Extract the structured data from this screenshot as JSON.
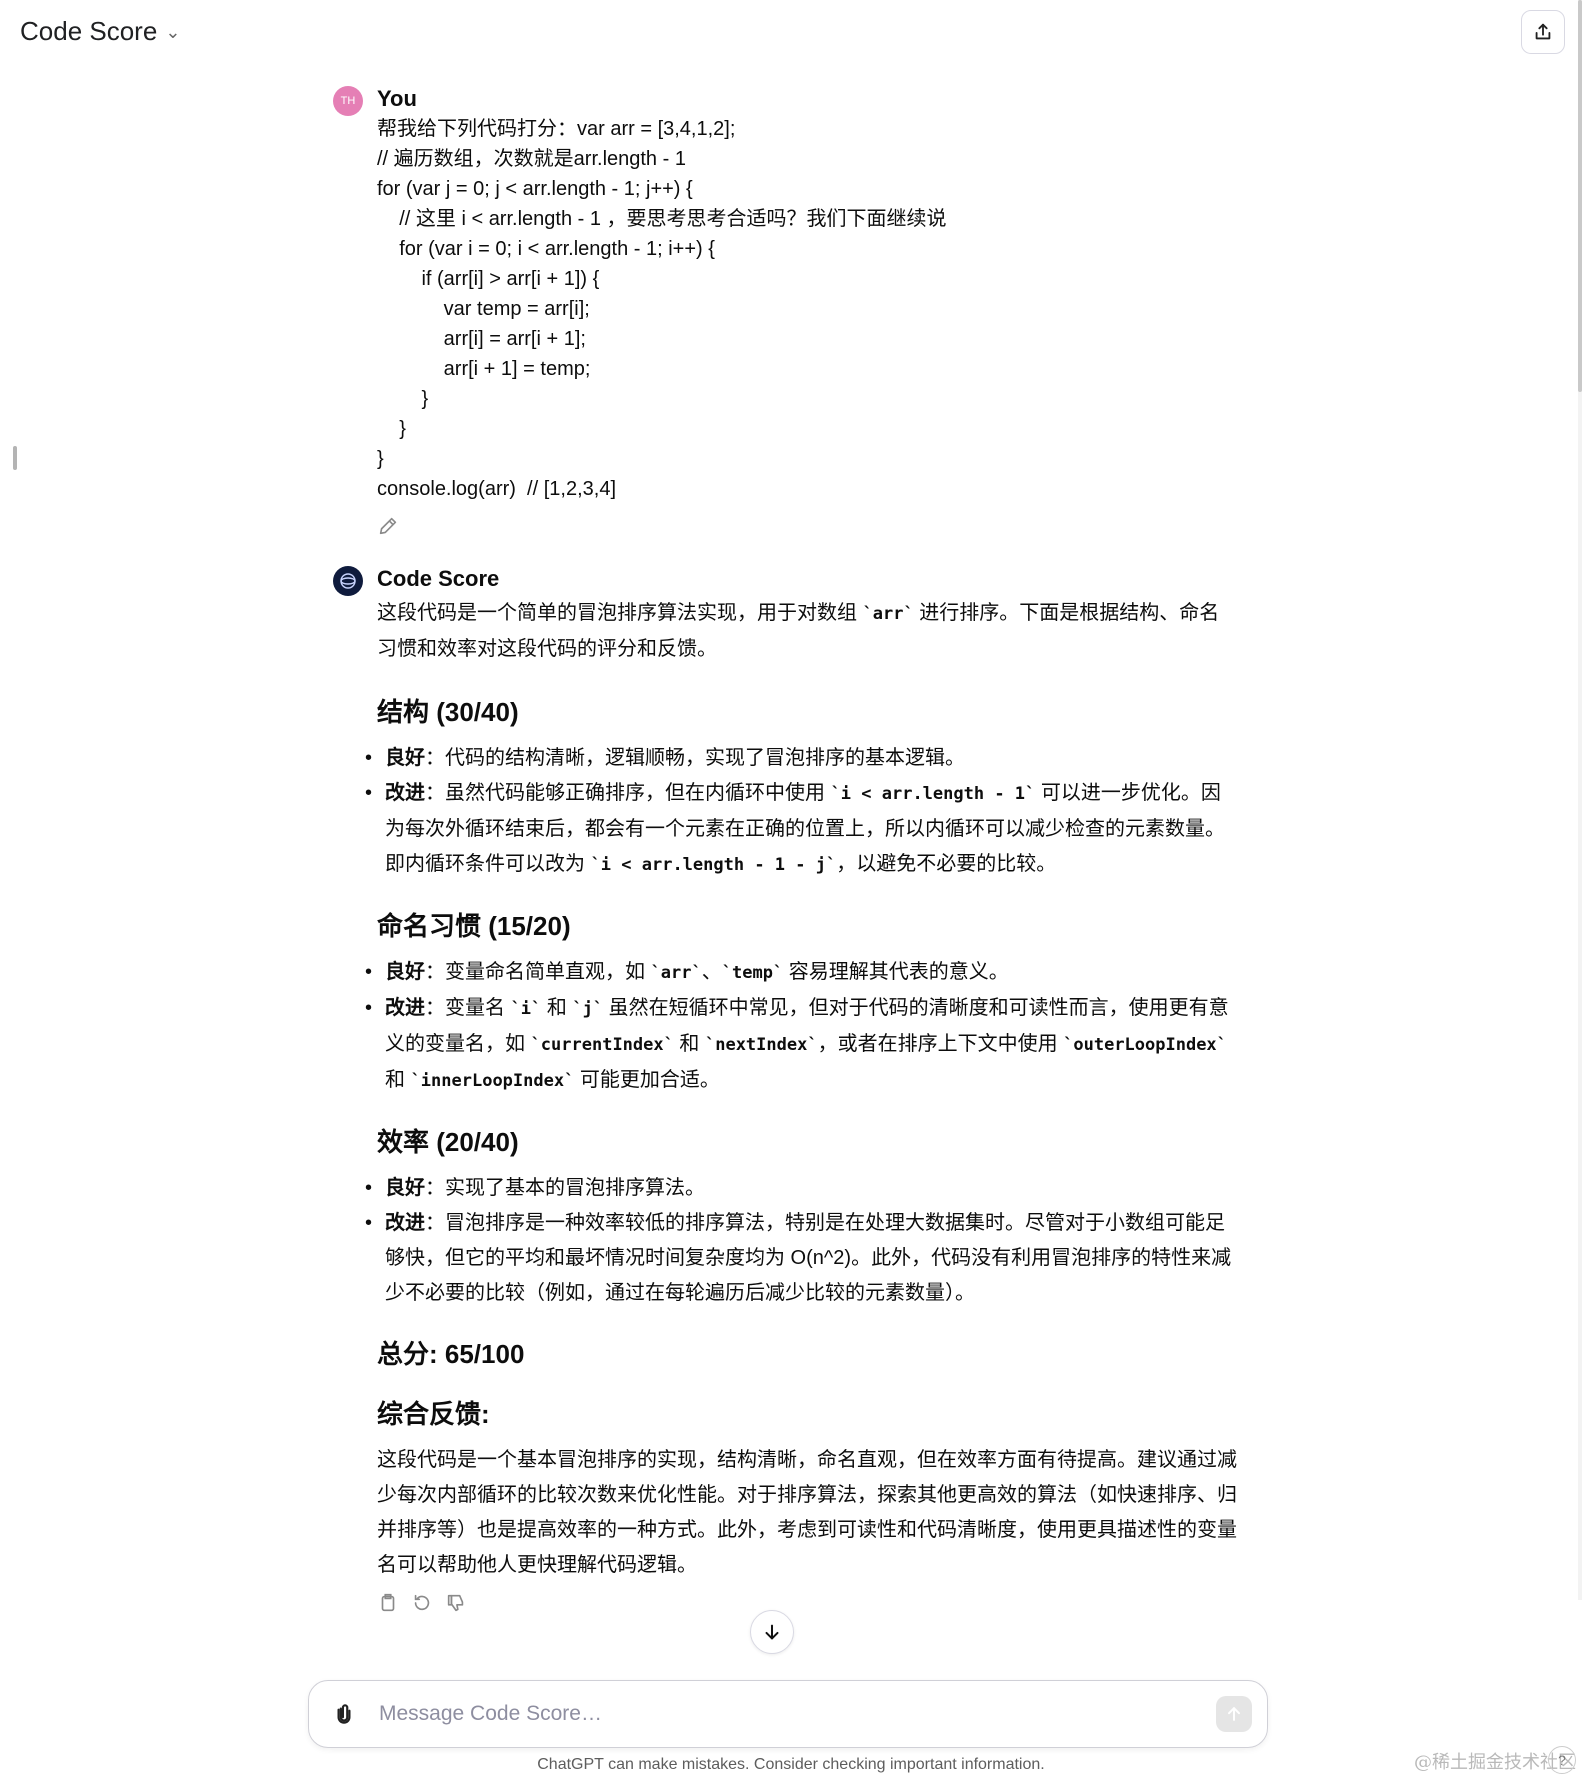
{
  "header": {
    "title": "Code Score"
  },
  "user_message": {
    "author": "You",
    "avatar_initials": "TH",
    "lines": [
      "帮我给下列代码打分：var arr = [3,4,1,2];",
      "// 遍历数组，次数就是arr.length - 1",
      "for (var j = 0; j < arr.length - 1; j++) {",
      "    // 这里 i < arr.length - 1 ，要思考思考合适吗？我们下面继续说",
      "    for (var i = 0; i < arr.length - 1; i++) {",
      "        if (arr[i] > arr[i + 1]) {",
      "            var temp = arr[i];",
      "            arr[i] = arr[i + 1];",
      "            arr[i + 1] = temp;",
      "        }",
      "    }",
      "}",
      "console.log(arr)  // [1,2,3,4]"
    ]
  },
  "bot_message": {
    "author": "Code Score",
    "intro": {
      "a": "这段代码是一个简单的冒泡排序算法实现，用于对数组 ",
      "code": "`arr`",
      "b": " 进行排序。下面是根据结构、命名习惯和效率对这段代码的评分和反馈。"
    },
    "structure": {
      "heading": "结构 (30/40)",
      "good_label": "良好",
      "good_text": "：代码的结构清晰，逻辑顺畅，实现了冒泡排序的基本逻辑。",
      "improve_label": "改进",
      "improve_a": "：虽然代码能够正确排序，但在内循环中使用 ",
      "improve_code1": "`i < arr.length - 1`",
      "improve_b": " 可以进一步优化。因为每次外循环结束后，都会有一个元素在正确的位置上，所以内循环可以减少检查的元素数量。即内循环条件可以改为 ",
      "improve_code2": "`i < arr.length - 1 - j`",
      "improve_c": "，以避免不必要的比较。"
    },
    "naming": {
      "heading": "命名习惯 (15/20)",
      "good_label": "良好",
      "good_a": "：变量命名简单直观，如 ",
      "good_code1": "`arr`",
      "good_b": "、",
      "good_code2": "`temp`",
      "good_c": " 容易理解其代表的意义。",
      "improve_label": "改进",
      "improve_a": "：变量名 ",
      "improve_code1": "`i`",
      "improve_b": " 和 ",
      "improve_code2": "`j`",
      "improve_c": " 虽然在短循环中常见，但对于代码的清晰度和可读性而言，使用更有意义的变量名，如 ",
      "improve_code3": "`currentIndex`",
      "improve_d": " 和 ",
      "improve_code4": "`nextIndex`",
      "improve_e": "，或者在排序上下文中使用 ",
      "improve_code5": "`outerLoopIndex`",
      "improve_f": " 和 ",
      "improve_code6": "`innerLoopIndex`",
      "improve_g": " 可能更加合适。"
    },
    "efficiency": {
      "heading": "效率 (20/40)",
      "good_label": "良好",
      "good_text": "：实现了基本的冒泡排序算法。",
      "improve_label": "改进",
      "improve_text": "：冒泡排序是一种效率较低的排序算法，特别是在处理大数据集时。尽管对于小数组可能足够快，但它的平均和最坏情况时间复杂度均为 O(n^2)。此外，代码没有利用冒泡排序的特性来减少不必要的比较（例如，通过在每轮遍历后减少比较的元素数量）。"
    },
    "total": "总分: 65/100",
    "summary_heading": "综合反馈:",
    "summary": "这段代码是一个基本冒泡排序的实现，结构清晰，命名直观，但在效率方面有待提高。建议通过减少每次内部循环的比较次数来优化性能。对于排序算法，探索其他更高效的算法（如快速排序、归并排序等）也是提高效率的一种方式。此外，考虑到可读性和代码清晰度，使用更具描述性的变量名可以帮助他人更快理解代码逻辑。"
  },
  "composer": {
    "placeholder": "Message Code Score…"
  },
  "footer": {
    "disclaimer": "ChatGPT can make mistakes. Consider checking important information.",
    "watermark": "@稀土掘金技术社区",
    "help": "?"
  }
}
